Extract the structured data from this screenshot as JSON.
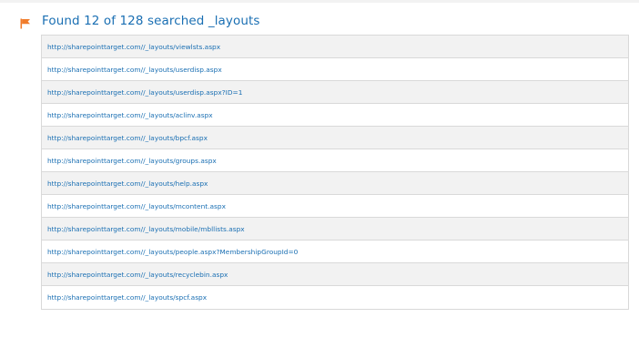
{
  "results": {
    "title": "Found 12 of 128 searched _layouts",
    "flag_icon": "flag-icon",
    "flag_color": "#f07c2b",
    "link_color": "#1a6fb3",
    "urls": [
      "http://sharepointtarget.com//_layouts/viewlsts.aspx",
      "http://sharepointtarget.com//_layouts/userdisp.aspx",
      "http://sharepointtarget.com//_layouts/userdisp.aspx?ID=1",
      "http://sharepointtarget.com//_layouts/aclinv.aspx",
      "http://sharepointtarget.com//_layouts/bpcf.aspx",
      "http://sharepointtarget.com//_layouts/groups.aspx",
      "http://sharepointtarget.com//_layouts/help.aspx",
      "http://sharepointtarget.com//_layouts/mcontent.aspx",
      "http://sharepointtarget.com//_layouts/mobile/mbllists.aspx",
      "http://sharepointtarget.com//_layouts/people.aspx?MembershipGroupId=0",
      "http://sharepointtarget.com//_layouts/recyclebin.aspx",
      "http://sharepointtarget.com//_layouts/spcf.aspx"
    ]
  }
}
